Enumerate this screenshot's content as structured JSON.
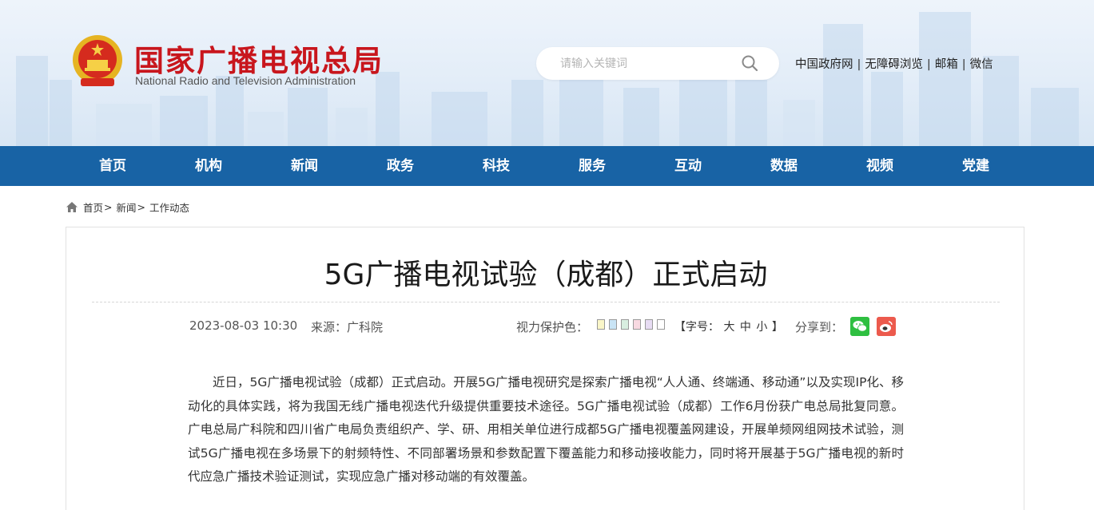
{
  "header": {
    "site_title": "国家广播电视总局",
    "site_subtitle": "National Radio and Television Administration",
    "search_placeholder": "请输入关键词",
    "top_links": [
      "中国政府网",
      "无障碍浏览",
      "邮箱",
      "微信"
    ],
    "separator": "|",
    "colors": {
      "title_red": "#c8161d",
      "nav_blue": "#1863a5"
    }
  },
  "nav": {
    "items": [
      {
        "label": "首页"
      },
      {
        "label": "机构"
      },
      {
        "label": "新闻"
      },
      {
        "label": "政务"
      },
      {
        "label": "科技"
      },
      {
        "label": "服务"
      },
      {
        "label": "互动"
      },
      {
        "label": "数据"
      },
      {
        "label": "视频"
      },
      {
        "label": "党建"
      }
    ]
  },
  "breadcrumb": {
    "items": [
      "首页",
      "新闻",
      "工作动态"
    ],
    "separator": ">"
  },
  "article": {
    "title": "5G广播电视试验（成都）正式启动",
    "date": "2023-08-03 10:30",
    "source": "来源：广科院",
    "eye_protection_label": "视力保护色：",
    "swatch_colors": [
      "#faf6c8",
      "#c9e4f5",
      "#d8eee0",
      "#f8d9e1",
      "#e7dcf3",
      "#ffffff"
    ],
    "font_size_label_open": "【字号：",
    "font_size_options": [
      "大",
      "中",
      "小"
    ],
    "font_size_label_close": "】",
    "share_label": "分享到：",
    "share_icons": [
      "wechat-icon",
      "weibo-icon"
    ],
    "body": "近日，5G广播电视试验（成都）正式启动。开展5G广播电视研究是探索广播电视“人人通、终端通、移动通”以及实现IP化、移动化的具体实践，将为我国无线广播电视迭代升级提供重要技术途径。5G广播电视试验（成都）工作6月份获广电总局批复同意。广电总局广科院和四川省广电局负责组织产、学、研、用相关单位进行成都5G广播电视覆盖网建设，开展单频网组网技术试验，测试5G广播电视在多场景下的射频特性、不同部署场景和参数配置下覆盖能力和移动接收能力，同时将开展基于5G广播电视的新时代应急广播技术验证测试，实现应急广播对移动端的有效覆盖。"
  }
}
